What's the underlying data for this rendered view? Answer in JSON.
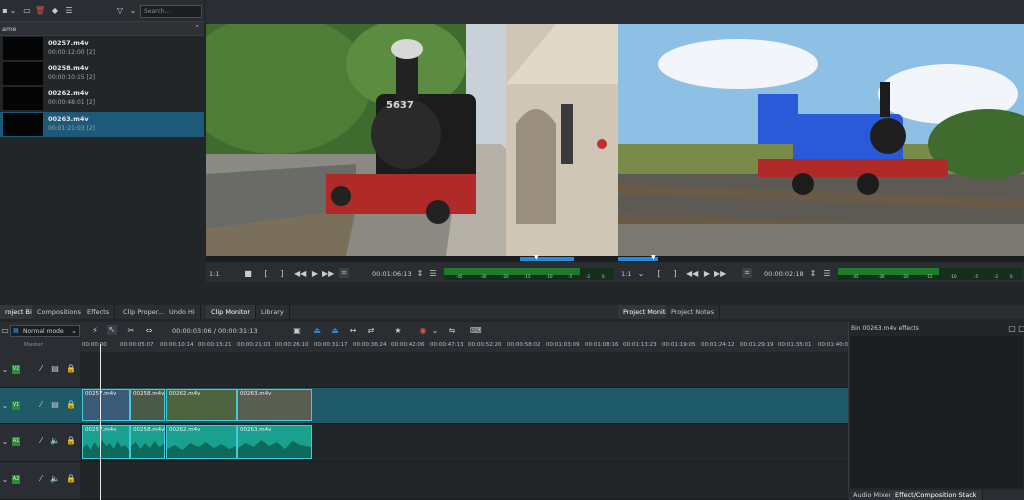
{
  "bin": {
    "search_placeholder": "Search...",
    "header_name": "ame",
    "clips": [
      {
        "name": "00257.m4v",
        "duration": "00:00:12:00 [2]"
      },
      {
        "name": "00258.m4v",
        "duration": "00:00:10:15 [2]"
      },
      {
        "name": "00262.m4v",
        "duration": "00:00:48:01 [2]"
      },
      {
        "name": "00263.m4v",
        "duration": "00:01:21:03 [2]"
      }
    ]
  },
  "clip_monitor": {
    "zoom": "1:1",
    "timecode": "00:01:06:13",
    "meter_labels": [
      "-45",
      "-30",
      "-20",
      "-15",
      "-10",
      "-5",
      "-2",
      "0"
    ]
  },
  "project_monitor": {
    "zoom": "1:1",
    "timecode": "00:00:02:18",
    "meter_labels": [
      "-45",
      "-30",
      "-20",
      "-15",
      "-10",
      "-5",
      "-2",
      "0"
    ]
  },
  "left_tabs": [
    "roject Bin",
    "Compositions",
    "Effects",
    "Clip Proper...",
    "Undo Hi"
  ],
  "mid_tabs": [
    "Clip Monitor",
    "Library"
  ],
  "right_tabs": [
    "Project Monitor",
    "Project Notes"
  ],
  "timeline": {
    "mode": "Normal mode",
    "position": "00:00:03:06 / 00:00:31:13",
    "ruler": [
      "00:00:00",
      "00:00:05:07",
      "00:00:10:14",
      "00:00:15:21",
      "00:00:21:03",
      "00:00:26:10",
      "00:00:31:17",
      "00:00:36:24",
      "00:00:42:06",
      "00:00:47:13",
      "00:00:52:20",
      "00:00:58:02",
      "00:01:03:09",
      "00:01:08:16",
      "00:01:13:23",
      "00:01:19:05",
      "00:01:24:12",
      "00:01:29:19",
      "00:01:35:01",
      "00:01:40:0"
    ],
    "master_label": "Master",
    "video_clips": [
      "00257.m4v",
      "00258.m4v",
      "00262.m4v",
      "00263.m4v"
    ],
    "audio_clips": [
      "00257.m4v",
      "00258.m4v",
      "00262.m4v",
      "00263.m4v"
    ],
    "tracks": [
      "V2",
      "V1",
      "A1",
      "A2"
    ]
  },
  "effects": {
    "title": "Bin 00263.m4v effects",
    "tabs": [
      "Audio Mixer",
      "Effect/Composition Stack"
    ]
  },
  "colors": {
    "accent": "#48c9d8",
    "selection": "#1d5a7a",
    "audio_clip": "#1aa08e",
    "track_badge": "#2e8b3a"
  }
}
